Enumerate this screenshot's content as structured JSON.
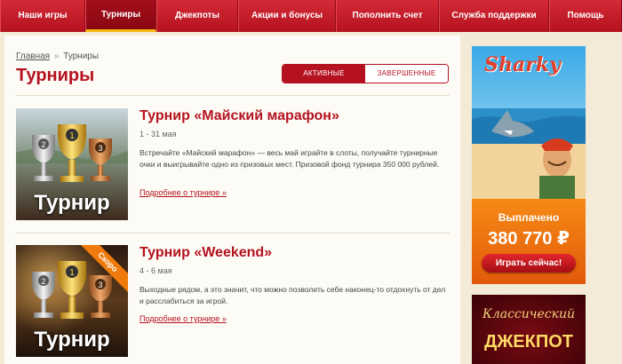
{
  "nav": {
    "items": [
      {
        "label": "Наши игры",
        "active": false
      },
      {
        "label": "Турниры",
        "active": true
      },
      {
        "label": "Джекпоты",
        "active": false
      },
      {
        "label": "Акции и бонусы",
        "active": false
      },
      {
        "label": "Пополнить счет",
        "active": false
      },
      {
        "label": "Служба поддержки",
        "active": false
      },
      {
        "label": "Помощь",
        "active": false
      }
    ]
  },
  "breadcrumb": {
    "home": "Главная",
    "separator": "»",
    "current": "Турниры"
  },
  "page": {
    "title": "Турниры"
  },
  "tabs": {
    "active_label": "АКТИВНЫЕ",
    "finished_label": "ЗАВЕРШЕННЫЕ",
    "selected": "active"
  },
  "tournaments": [
    {
      "image_label": "Турнир",
      "title": "Турнир «Майский марафон»",
      "dates": "1 - 31 мая",
      "description": "Встречайте «Майский марафон» — весь май играйте в слоты, получайте турнирные очки и выигрывайте одно из призовых мест. Призовой фонд турнира 350 000 рублей.",
      "more_link": "Подробнее о турнире »",
      "badge": ""
    },
    {
      "image_label": "Турнир",
      "title": "Турнир «Weekend»",
      "dates": "4 - 6 мая",
      "description": "Выходные рядом, а это значит, что можно позволить себе наконец-то отдохнуть от дел и расслабиться за игрой.",
      "more_link": "Подробнее о турнире »",
      "badge": "Скоро"
    }
  ],
  "sidebar": {
    "sharky": {
      "logo_text": "Sharky",
      "paid_label": "Выплачено",
      "paid_amount": "380 770 ₽",
      "play_button": "Играть сейчас!"
    },
    "jackpot": {
      "line1": "Классический",
      "line2": "ДЖЕКПОТ"
    }
  },
  "colors": {
    "brand_red": "#b5121f",
    "nav_active_underline": "#f5b80f",
    "banner_orange": "#f68a15",
    "soon_badge": "#f07b0c"
  }
}
